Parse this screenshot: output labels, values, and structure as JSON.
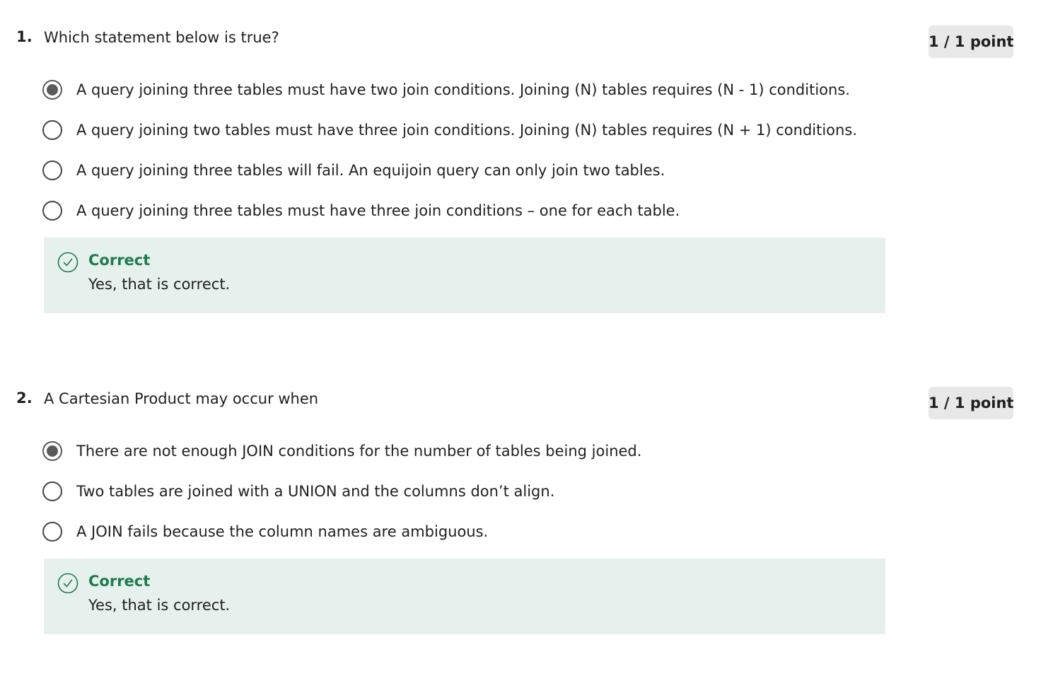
{
  "questions": [
    {
      "number": "1.",
      "prompt": "Which statement below is true?",
      "points": "1 / 1 point",
      "options": [
        {
          "label": "A query joining three tables must have two join conditions. Joining (N) tables requires (N - 1) conditions.",
          "selected": true
        },
        {
          "label": "A query joining two tables must have three join conditions. Joining (N) tables requires (N + 1) conditions.",
          "selected": false
        },
        {
          "label": "A query joining three tables will fail. An equijoin query can only join two tables.",
          "selected": false
        },
        {
          "label": "A query joining three tables must have three join conditions – one for each table.",
          "selected": false
        }
      ],
      "feedback": {
        "icon": "check-circle-icon",
        "title": "Correct",
        "text": "Yes, that is correct."
      }
    },
    {
      "number": "2.",
      "prompt": "A Cartesian Product may occur when",
      "points": "1 / 1 point",
      "options": [
        {
          "label": "There are not enough JOIN conditions for the number of tables being joined.",
          "selected": true
        },
        {
          "label": "Two tables are joined with a UNION and the columns don’t align.",
          "selected": false
        },
        {
          "label": "A JOIN fails because the column names are ambiguous.",
          "selected": false
        }
      ],
      "feedback": {
        "icon": "check-circle-icon",
        "title": "Correct",
        "text": "Yes, that is correct."
      }
    }
  ],
  "colors": {
    "feedback_bg": "#e6f1ed",
    "correct_green": "#1f7a4d",
    "badge_bg": "#e8e8e8",
    "radio_selected": "#5a5a5a"
  }
}
